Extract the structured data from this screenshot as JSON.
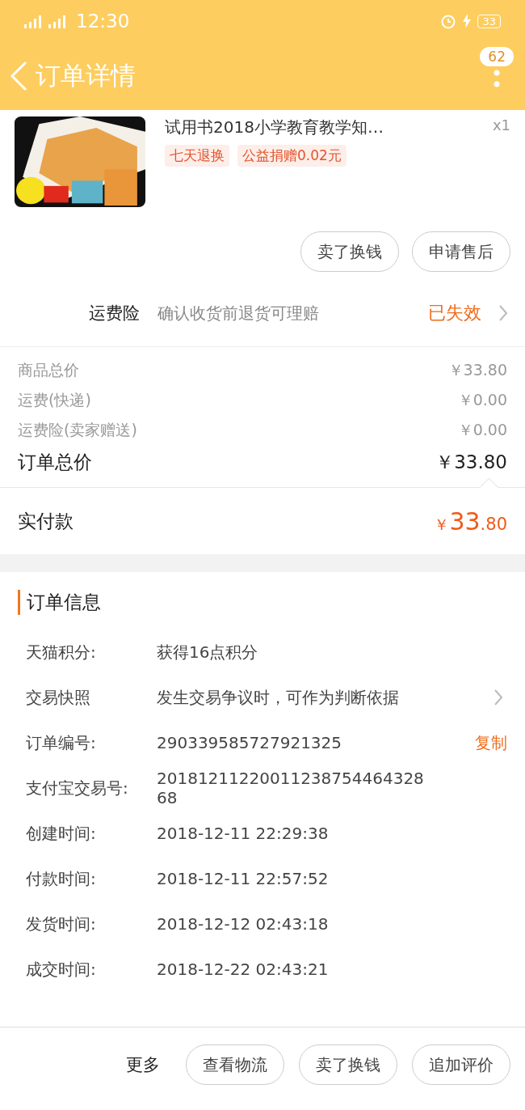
{
  "status_bar": {
    "time": "12:30",
    "battery": "33"
  },
  "header": {
    "title": "订单详情",
    "badge": "62"
  },
  "product": {
    "title": "试用书2018小学教育教学知…",
    "quantity": "x1",
    "tags": [
      "七天退换",
      "公益捐赠0.02元"
    ]
  },
  "product_actions": [
    "卖了换钱",
    "申请售后"
  ],
  "insurance": {
    "label": "运费险",
    "description": "确认收货前退货可理赔",
    "status": "已失效"
  },
  "prices": [
    {
      "label": "商品总价",
      "value": "￥33.80",
      "emphasis": false
    },
    {
      "label": "运费(快递)",
      "value": "￥0.00",
      "emphasis": false
    },
    {
      "label": "运费险(卖家赠送)",
      "value": "￥0.00",
      "emphasis": false
    },
    {
      "label": "订单总价",
      "value": "￥33.80",
      "emphasis": true
    }
  ],
  "paid": {
    "label": "实付款",
    "currency": "￥",
    "integer": "33",
    "decimal": ".80"
  },
  "order_info": {
    "title": "订单信息",
    "rows": [
      {
        "kind": "plain",
        "label": "天猫积分:",
        "value": "获得16点积分"
      },
      {
        "kind": "link",
        "label": "交易快照",
        "value": "发生交易争议时，可作为判断依据"
      },
      {
        "kind": "copy",
        "label": "订单编号:",
        "value": "290339585727921325",
        "action": "复制"
      },
      {
        "kind": "plain",
        "label": "支付宝交易号:",
        "value": "2018121122001123875446432868"
      },
      {
        "kind": "plain",
        "label": "创建时间:",
        "value": "2018-12-11 22:29:38"
      },
      {
        "kind": "plain",
        "label": "付款时间:",
        "value": "2018-12-11 22:57:52"
      },
      {
        "kind": "plain",
        "label": "发货时间:",
        "value": "2018-12-12 02:43:18"
      },
      {
        "kind": "plain",
        "label": "成交时间:",
        "value": "2018-12-22 02:43:21"
      }
    ]
  },
  "bottom_bar": {
    "more": "更多",
    "buttons": [
      "查看物流",
      "卖了换钱",
      "追加评价"
    ]
  }
}
